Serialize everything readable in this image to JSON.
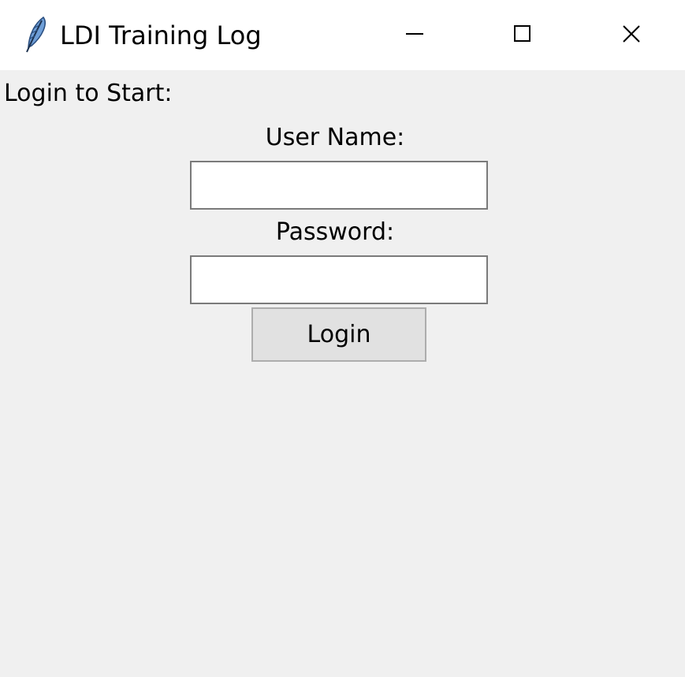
{
  "window": {
    "title": "LDI Training Log",
    "app_icon": "feather-icon",
    "controls": {
      "minimize_icon": "minimize-icon",
      "maximize_icon": "maximize-icon",
      "close_icon": "close-icon"
    }
  },
  "login": {
    "prompt": "Login to Start:",
    "username_label": "User Name:",
    "username_value": "",
    "password_label": "Password:",
    "password_value": "",
    "button_label": "Login"
  },
  "colors": {
    "titlebar_bg": "#ffffff",
    "window_bg": "#f0f0f0",
    "button_bg": "#e1e1e1",
    "button_border": "#adadad",
    "entry_border": "#7a7a7a",
    "feather_blue": "#4a7fc1"
  }
}
